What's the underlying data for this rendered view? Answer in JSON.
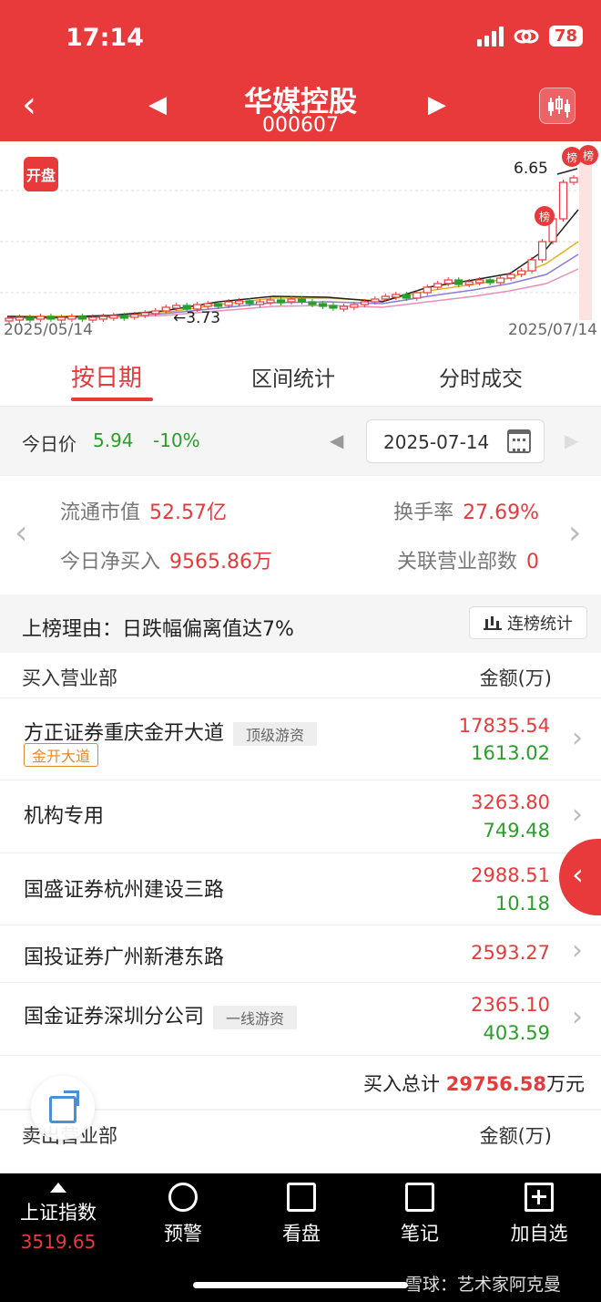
{
  "status": {
    "time": "17:14",
    "battery": "78"
  },
  "header": {
    "title": "华媒控股",
    "code": "000607"
  },
  "chart": {
    "badge": "开盘",
    "start_date": "2025/05/14",
    "end_date": "2025/07/14",
    "high_label": "6.65",
    "low_label": "←3.73",
    "marker": "榜",
    "colors": {
      "up": "#e8393b",
      "down": "#2a9d2a"
    }
  },
  "tabs": [
    {
      "label": "按日期"
    },
    {
      "label": "区间统计"
    },
    {
      "label": "分时成交"
    }
  ],
  "price_bar": {
    "label": "今日价",
    "price": "5.94",
    "change": "-10%",
    "date": "2025-07-14"
  },
  "stats": {
    "float_cap_label": "流通市值",
    "float_cap": "52.57亿",
    "turnover_label": "换手率",
    "turnover": "27.69%",
    "net_buy_label": "今日净买入",
    "net_buy": "9565.86万",
    "related_label": "关联营业部数",
    "related": "0"
  },
  "reason": {
    "text": "上榜理由：日跌幅偏离值达7%",
    "button": "连榜统计"
  },
  "buy_list": {
    "header_left": "买入营业部",
    "header_right": "金额(万)",
    "rows": [
      {
        "name": "方正证券重庆金开大道",
        "tag": "顶级游资",
        "sub": "金开大道",
        "buy": "17835.54",
        "sell": "1613.02"
      },
      {
        "name": "机构专用",
        "buy": "3263.80",
        "sell": "749.48"
      },
      {
        "name": "国盛证券杭州建设三路",
        "buy": "2988.51",
        "sell": "10.18"
      },
      {
        "name": "国投证券广州新港东路",
        "buy": "2593.27"
      },
      {
        "name": "国金证券深圳分公司",
        "tag": "一线游资",
        "buy": "2365.10",
        "sell": "403.59"
      }
    ],
    "total_prefix": "买入总计",
    "total_value": "29756.58",
    "total_unit": "万元"
  },
  "sell_list": {
    "header_left": "卖出营业部",
    "header_right": "金额(万)"
  },
  "bottom_nav": {
    "index_name": "上证指数",
    "index_value": "3519.65",
    "items": [
      "预警",
      "看盘",
      "笔记",
      "加自选"
    ]
  },
  "watermark": "雪球：艺术家阿克曼"
}
